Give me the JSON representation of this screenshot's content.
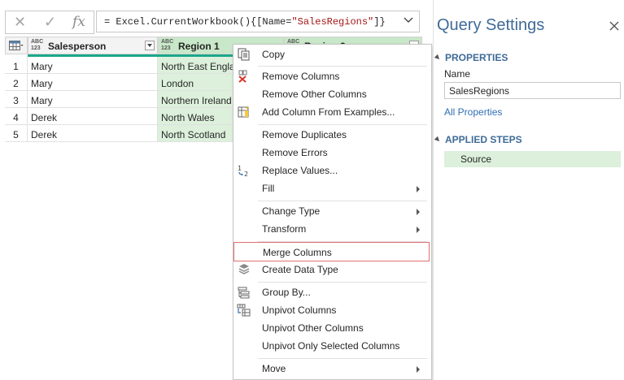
{
  "formula_bar": {
    "cancel_icon": "x-icon",
    "commit_icon": "check-icon",
    "fx_label": "fx",
    "prefix": "= Excel.CurrentWorkbook(){[Name=",
    "string": "\"SalesRegions\"",
    "suffix": "]}"
  },
  "grid": {
    "type_label": "ABC\n123",
    "columns": [
      {
        "name": "Salesperson",
        "type": "ABC\n123"
      },
      {
        "name": "Region 1",
        "type": "ABC\n123"
      },
      {
        "name": "Region 2",
        "type": "ABC\n123"
      }
    ],
    "rows": [
      {
        "num": "1",
        "salesperson": "Mary",
        "region1": "North East England"
      },
      {
        "num": "2",
        "salesperson": "Mary",
        "region1": "London"
      },
      {
        "num": "3",
        "salesperson": "Mary",
        "region1": "Northern Ireland"
      },
      {
        "num": "4",
        "salesperson": "Derek",
        "region1": "North Wales"
      },
      {
        "num": "5",
        "salesperson": "Derek",
        "region1": "North Scotland"
      }
    ]
  },
  "context_menu": {
    "items": [
      {
        "label": "Copy",
        "icon": "copy-icon"
      },
      {
        "label": "Remove Columns",
        "icon": "remove-columns-icon"
      },
      {
        "label": "Remove Other Columns"
      },
      {
        "label": "Add Column From Examples...",
        "icon": "add-column-examples-icon"
      },
      {
        "label": "Remove Duplicates"
      },
      {
        "label": "Remove Errors"
      },
      {
        "label": "Replace Values...",
        "icon": "replace-values-icon"
      },
      {
        "label": "Fill",
        "submenu": true
      },
      {
        "label": "Change Type",
        "submenu": true
      },
      {
        "label": "Transform",
        "submenu": true
      },
      {
        "label": "Merge Columns",
        "highlighted": true
      },
      {
        "label": "Create Data Type",
        "icon": "data-type-icon"
      },
      {
        "label": "Group By...",
        "icon": "group-by-icon"
      },
      {
        "label": "Unpivot Columns",
        "icon": "unpivot-icon"
      },
      {
        "label": "Unpivot Other Columns"
      },
      {
        "label": "Unpivot Only Selected Columns"
      },
      {
        "label": "Move",
        "submenu": true
      }
    ],
    "highlight_color": "#e07070"
  },
  "query_settings": {
    "title": "Query Settings",
    "properties_header": "PROPERTIES",
    "name_label": "Name",
    "name_value": "SalesRegions",
    "all_properties_link": "All Properties",
    "applied_steps_header": "APPLIED STEPS",
    "steps": [
      "Source"
    ]
  },
  "colors": {
    "accent": "#3f6b98",
    "selected_column": "#dcf0dc",
    "quality_bar": "#1aa88a",
    "link": "#2f6fb4"
  }
}
